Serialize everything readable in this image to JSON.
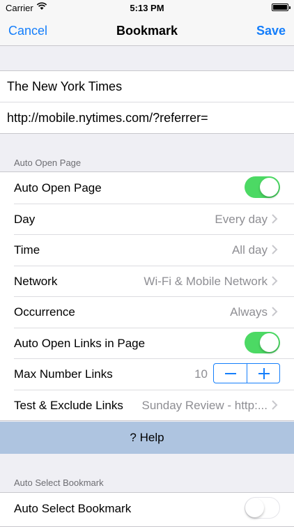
{
  "status": {
    "carrier": "Carrier",
    "time": "5:13 PM"
  },
  "nav": {
    "cancel": "Cancel",
    "title": "Bookmark",
    "save": "Save",
    "accent": "#147efb"
  },
  "bookmark": {
    "name": "The New York Times",
    "url": "http://mobile.nytimes.com/?referrer="
  },
  "section1": {
    "header": "Auto Open Page",
    "rows": [
      {
        "label": "Auto Open Page",
        "toggle": "on"
      },
      {
        "label": "Day",
        "value": "Every day"
      },
      {
        "label": "Time",
        "value": "All day"
      },
      {
        "label": "Network",
        "value": "Wi-Fi & Mobile Network"
      },
      {
        "label": "Occurrence",
        "value": "Always"
      },
      {
        "label": "Auto Open Links in Page",
        "toggle": "on"
      },
      {
        "label": "Max Number Links",
        "value": "10"
      },
      {
        "label": "Test & Exclude Links",
        "value": "Sunday Review - http:..."
      }
    ]
  },
  "help": {
    "label": "? Help"
  },
  "section2": {
    "header": "Auto Select Bookmark",
    "rows": [
      {
        "label": "Auto Select Bookmark",
        "toggle": "off"
      }
    ]
  },
  "icons": {
    "wifi": "wifi-icon",
    "battery": "battery-icon",
    "chevron": "chevron-right-icon",
    "minus": "minus-icon",
    "plus": "plus-icon"
  },
  "colors": {
    "switch_on": "#4cd964",
    "help_bar": "#aec4e0",
    "background": "#efeff4"
  }
}
